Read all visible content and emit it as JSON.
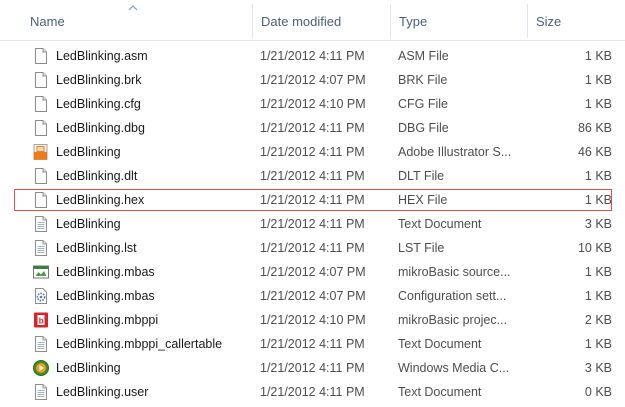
{
  "columns": {
    "name": "Name",
    "date": "Date modified",
    "type": "Type",
    "size": "Size"
  },
  "colors": {
    "selection_border": "#d9534f",
    "header_text": "#4c607a"
  },
  "files": [
    {
      "name": "LedBlinking.asm",
      "date": "1/21/2012 4:11 PM",
      "type": "ASM File",
      "size": "1 KB",
      "icon": "generic-file-icon"
    },
    {
      "name": "LedBlinking.brk",
      "date": "1/21/2012 4:07 PM",
      "type": "BRK File",
      "size": "1 KB",
      "icon": "generic-file-icon"
    },
    {
      "name": "LedBlinking.cfg",
      "date": "1/21/2012 4:10 PM",
      "type": "CFG File",
      "size": "1 KB",
      "icon": "generic-file-icon"
    },
    {
      "name": "LedBlinking.dbg",
      "date": "1/21/2012 4:11 PM",
      "type": "DBG File",
      "size": "86 KB",
      "icon": "generic-file-icon"
    },
    {
      "name": "LedBlinking",
      "date": "1/21/2012 4:11 PM",
      "type": "Adobe Illustrator S...",
      "size": "46 KB",
      "icon": "illustrator-file-icon"
    },
    {
      "name": "LedBlinking.dlt",
      "date": "1/21/2012 4:11 PM",
      "type": "DLT File",
      "size": "1 KB",
      "icon": "generic-file-icon"
    },
    {
      "name": "LedBlinking.hex",
      "date": "1/21/2012 4:11 PM",
      "type": "HEX File",
      "size": "1 KB",
      "icon": "generic-file-icon",
      "selected": true
    },
    {
      "name": "LedBlinking",
      "date": "1/21/2012 4:11 PM",
      "type": "Text Document",
      "size": "3 KB",
      "icon": "text-document-icon"
    },
    {
      "name": "LedBlinking.lst",
      "date": "1/21/2012 4:11 PM",
      "type": "LST File",
      "size": "10 KB",
      "icon": "text-document-icon"
    },
    {
      "name": "LedBlinking.mbas",
      "date": "1/21/2012 4:07 PM",
      "type": "mikroBasic source...",
      "size": "1 KB",
      "icon": "mikrobasic-source-icon"
    },
    {
      "name": "LedBlinking.mbas",
      "date": "1/21/2012 4:07 PM",
      "type": "Configuration sett...",
      "size": "1 KB",
      "icon": "configuration-settings-icon"
    },
    {
      "name": "LedBlinking.mbppi",
      "date": "1/21/2012 4:10 PM",
      "type": "mikroBasic projec...",
      "size": "2 KB",
      "icon": "mikrobasic-project-icon"
    },
    {
      "name": "LedBlinking.mbppi_callertable",
      "date": "1/21/2012 4:11 PM",
      "type": "Text Document",
      "size": "1 KB",
      "icon": "text-document-icon"
    },
    {
      "name": "LedBlinking",
      "date": "1/21/2012 4:11 PM",
      "type": "Windows Media C...",
      "size": "3 KB",
      "icon": "windows-media-icon"
    },
    {
      "name": "LedBlinking.user",
      "date": "1/21/2012 4:11 PM",
      "type": "Text Document",
      "size": "0 KB",
      "icon": "text-document-icon"
    }
  ]
}
